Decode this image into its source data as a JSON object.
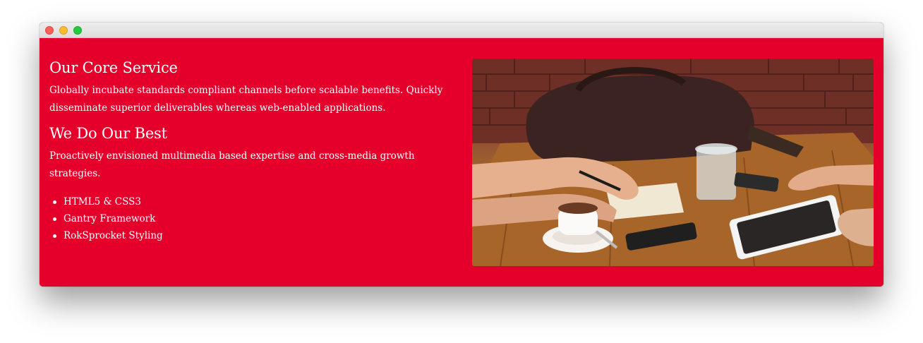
{
  "window": {
    "controls": [
      "close",
      "minimize",
      "zoom"
    ],
    "accent_color": "#e4002b"
  },
  "section": {
    "heading_1": "Our Core Service",
    "paragraph_1": "Globally incubate standards compliant channels before scalable benefits. Quickly disseminate superior deliverables whereas web-enabled applications.",
    "heading_2": "We Do Our Best",
    "paragraph_2": "Proactively envisioned multimedia based expertise and cross-media growth strategies.",
    "features": [
      "HTML5 & CSS3",
      "Gantry Framework",
      "RokSprocket Styling"
    ]
  },
  "image": {
    "subject": "meeting-table-photo"
  }
}
